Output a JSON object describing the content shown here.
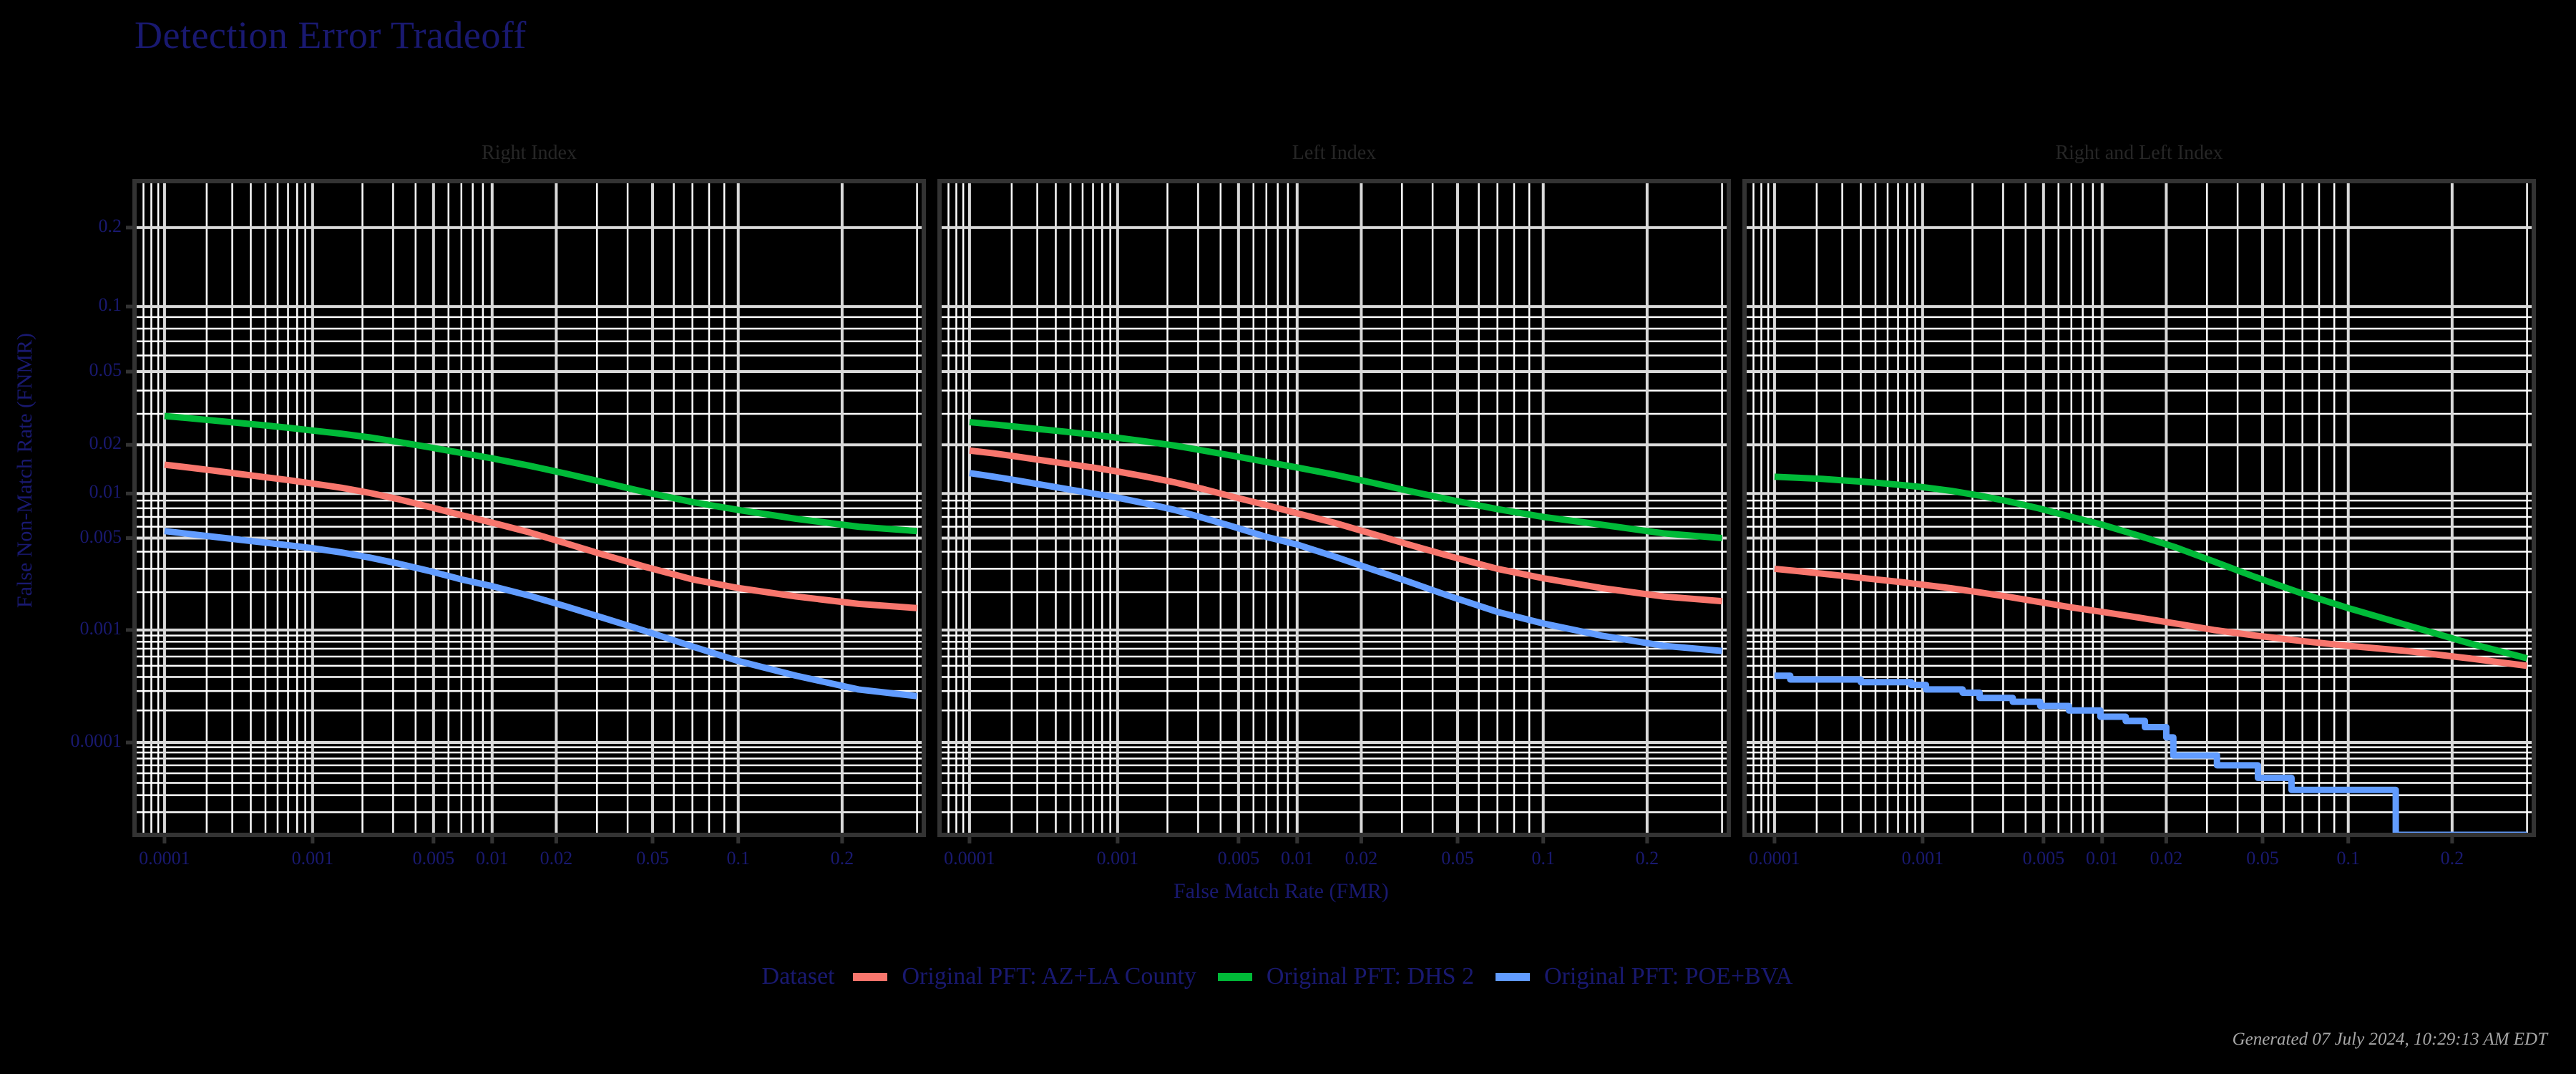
{
  "title": "Detection Error Tradeoff",
  "axes": {
    "x_title": "False Match Rate (FMR)",
    "y_title": "False Non-Match Rate (FNMR)",
    "x_ticks": [
      "0.0001",
      "0.001",
      "0.005",
      "0.01",
      "0.02",
      "0.05",
      "0.1",
      "0.2"
    ],
    "y_ticks": [
      "0.2",
      "0.1",
      "0.05",
      "0.02",
      "0.01",
      "0.005",
      "0.001",
      "0.0001"
    ]
  },
  "panels": [
    {
      "label": "Right Index"
    },
    {
      "label": "Left Index"
    },
    {
      "label": "Right and Left Index"
    }
  ],
  "legend": {
    "title": "Dataset",
    "items": [
      {
        "label": "Original PFT: AZ+LA County",
        "color": "#F8766D"
      },
      {
        "label": "Original PFT: DHS 2",
        "color": "#00BA38"
      },
      {
        "label": "Original PFT: POE+BVA",
        "color": "#619CFF"
      }
    ]
  },
  "caption": "Generated 07 July 2024, 10:29:13 AM EDT",
  "colors": {
    "title": "#191970",
    "strip": "#262626",
    "background": "#000000",
    "grid_major": "#d9d9d9",
    "grid_minor": "#ffffff",
    "panel_border": "#333333",
    "caption": "#a6a6a6"
  },
  "chart_data": {
    "type": "line",
    "title": "Detection Error Tradeoff",
    "xlabel": "False Match Rate (FMR)",
    "ylabel": "False Non-Match Rate (FNMR)",
    "xscale": "probit",
    "yscale": "probit",
    "xlim": [
      6e-05,
      0.31
    ],
    "ylim": [
      1.15e-05,
      0.28
    ],
    "xticks": [
      0.0001,
      0.001,
      0.005,
      0.01,
      0.02,
      0.05,
      0.1,
      0.2
    ],
    "yticks": [
      0.2,
      0.1,
      0.05,
      0.02,
      0.01,
      0.005,
      0.001,
      0.0001
    ],
    "grid": true,
    "legend_position": "bottom",
    "facets": [
      {
        "name": "Right Index",
        "series": [
          {
            "name": "Original PFT: AZ+LA County",
            "color": "#F8766D",
            "x": [
              0.0001,
              0.00015,
              0.00022,
              0.00032,
              0.00047,
              0.0007,
              0.001,
              0.0015,
              0.0022,
              0.0032,
              0.0047,
              0.007,
              0.01,
              0.015,
              0.022,
              0.032,
              0.047,
              0.07,
              0.1,
              0.15,
              0.22,
              0.3
            ],
            "y": [
              0.0152,
              0.0146,
              0.014,
              0.0134,
              0.0128,
              0.0122,
              0.0116,
              0.0109,
              0.0101,
              0.0092,
              0.0082,
              0.0072,
              0.0064,
              0.0055,
              0.0046,
              0.0038,
              0.0031,
              0.0025,
              0.00215,
              0.00185,
              0.00162,
              0.0015
            ]
          },
          {
            "name": "Original PFT: DHS 2",
            "color": "#00BA38",
            "x": [
              0.0001,
              0.00015,
              0.00022,
              0.00032,
              0.00047,
              0.0007,
              0.001,
              0.0015,
              0.0022,
              0.0032,
              0.0047,
              0.007,
              0.01,
              0.015,
              0.022,
              0.032,
              0.047,
              0.07,
              0.1,
              0.15,
              0.22,
              0.3
            ],
            "y": [
              0.0292,
              0.0284,
              0.0276,
              0.0268,
              0.026,
              0.0251,
              0.0242,
              0.0232,
              0.0221,
              0.0208,
              0.0194,
              0.0179,
              0.0166,
              0.015,
              0.0134,
              0.0118,
              0.0102,
              0.0088,
              0.0078,
              0.0068,
              0.006,
              0.0056
            ]
          },
          {
            "name": "Original PFT: POE+BVA",
            "color": "#619CFF",
            "x": [
              0.0001,
              0.00015,
              0.00022,
              0.00032,
              0.00047,
              0.0007,
              0.001,
              0.0015,
              0.0022,
              0.0032,
              0.0047,
              0.007,
              0.01,
              0.015,
              0.022,
              0.032,
              0.047,
              0.07,
              0.1,
              0.15,
              0.22,
              0.3
            ],
            "y": [
              0.0056,
              0.00535,
              0.00512,
              0.0049,
              0.00468,
              0.00445,
              0.00424,
              0.00395,
              0.00363,
              0.00328,
              0.0029,
              0.0025,
              0.00222,
              0.00188,
              0.00155,
              0.00125,
              0.00098,
              0.00073,
              0.00055,
              0.00041,
              0.00031,
              0.00027
            ]
          }
        ]
      },
      {
        "name": "Left Index",
        "series": [
          {
            "name": "Original PFT: AZ+LA County",
            "color": "#F8766D",
            "x": [
              0.0001,
              0.00015,
              0.00022,
              0.00032,
              0.00047,
              0.0007,
              0.001,
              0.0015,
              0.0022,
              0.0032,
              0.0047,
              0.007,
              0.01,
              0.015,
              0.022,
              0.032,
              0.047,
              0.07,
              0.1,
              0.15,
              0.22,
              0.3
            ],
            "y": [
              0.0185,
              0.0178,
              0.017,
              0.0162,
              0.0154,
              0.0146,
              0.0138,
              0.0128,
              0.0118,
              0.0107,
              0.0095,
              0.0084,
              0.0074,
              0.0064,
              0.0054,
              0.0045,
              0.0037,
              0.003,
              0.00255,
              0.00215,
              0.00185,
              0.0017
            ]
          },
          {
            "name": "Original PFT: DHS 2",
            "color": "#00BA38",
            "x": [
              0.0001,
              0.00015,
              0.00022,
              0.00032,
              0.00047,
              0.0007,
              0.001,
              0.0015,
              0.0022,
              0.0032,
              0.0047,
              0.007,
              0.01,
              0.015,
              0.022,
              0.032,
              0.047,
              0.07,
              0.1,
              0.15,
              0.22,
              0.3
            ],
            "y": [
              0.027,
              0.0262,
              0.0254,
              0.0246,
              0.0238,
              0.0229,
              0.022,
              0.0209,
              0.0198,
              0.0185,
              0.0172,
              0.0158,
              0.0146,
              0.0132,
              0.0118,
              0.0104,
              0.0091,
              0.0079,
              0.007,
              0.0062,
              0.0054,
              0.005
            ]
          },
          {
            "name": "Original PFT: POE+BVA",
            "color": "#619CFF",
            "x": [
              0.0001,
              0.00015,
              0.00022,
              0.00032,
              0.00047,
              0.0007,
              0.001,
              0.0015,
              0.0022,
              0.0032,
              0.0047,
              0.007,
              0.01,
              0.015,
              0.022,
              0.032,
              0.047,
              0.07,
              0.1,
              0.15,
              0.22,
              0.3
            ],
            "y": [
              0.0135,
              0.0128,
              0.0121,
              0.0114,
              0.0107,
              0.01,
              0.0094,
              0.0086,
              0.0078,
              0.0069,
              0.006,
              0.0051,
              0.0045,
              0.0037,
              0.003,
              0.0024,
              0.00185,
              0.0014,
              0.00113,
              0.0009,
              0.00074,
              0.00067
            ]
          }
        ]
      },
      {
        "name": "Right and Left Index",
        "series": [
          {
            "name": "Original PFT: AZ+LA County",
            "color": "#F8766D",
            "x": [
              0.0001,
              0.00015,
              0.00022,
              0.00032,
              0.00047,
              0.0007,
              0.001,
              0.0015,
              0.0022,
              0.0032,
              0.0047,
              0.007,
              0.01,
              0.015,
              0.022,
              0.032,
              0.047,
              0.07,
              0.1,
              0.15,
              0.22,
              0.3
            ],
            "y": [
              0.003,
              0.00288,
              0.00276,
              0.00264,
              0.00252,
              0.0024,
              0.00228,
              0.00214,
              0.00199,
              0.00184,
              0.00168,
              0.00152,
              0.0014,
              0.00126,
              0.00113,
              0.001,
              0.0009,
              0.00081,
              0.00074,
              0.00067,
              0.00058,
              0.0005
            ]
          },
          {
            "name": "Original PFT: DHS 2",
            "color": "#00BA38",
            "x": [
              0.0001,
              0.00015,
              0.00022,
              0.00032,
              0.00047,
              0.0007,
              0.001,
              0.0015,
              0.0022,
              0.0032,
              0.0047,
              0.007,
              0.01,
              0.015,
              0.022,
              0.032,
              0.047,
              0.07,
              0.1,
              0.15,
              0.22,
              0.3
            ],
            "y": [
              0.0128,
              0.0126,
              0.0124,
              0.0121,
              0.0118,
              0.0114,
              0.011,
              0.0104,
              0.0097,
              0.0089,
              0.008,
              0.007,
              0.0062,
              0.0052,
              0.0043,
              0.0034,
              0.0026,
              0.00195,
              0.0015,
              0.0011,
              0.00078,
              0.00058
            ]
          },
          {
            "name": "Original PFT: POE+BVA",
            "color": "#619CFF",
            "steps": true,
            "x": [
              0.0001,
              0.00013,
              0.00013,
              0.0004,
              0.0004,
              0.00085,
              0.00085,
              0.00105,
              0.00105,
              0.00175,
              0.00175,
              0.0022,
              0.0022,
              0.0034,
              0.0034,
              0.0048,
              0.0048,
              0.0068,
              0.0068,
              0.0098,
              0.0098,
              0.013,
              0.013,
              0.016,
              0.016,
              0.02,
              0.02,
              0.0215,
              0.0215,
              0.033,
              0.033,
              0.048,
              0.048,
              0.064,
              0.064,
              0.135,
              0.135,
              0.14,
              0.14,
              0.3
            ],
            "y": [
              0.00041,
              0.00041,
              0.00038,
              0.00038,
              0.00036,
              0.00036,
              0.00034,
              0.00034,
              0.00031,
              0.00031,
              0.00029,
              0.00029,
              0.00026,
              0.00026,
              0.00024,
              0.00024,
              0.00022,
              0.00022,
              0.0002,
              0.0002,
              0.000175,
              0.000175,
              0.00016,
              0.00016,
              0.00014,
              0.00014,
              0.000112,
              0.000112,
              7.5e-05,
              7.5e-05,
              6e-05,
              6e-05,
              4.5e-05,
              4.5e-05,
              3.4e-05,
              3.4e-05,
              3.4e-05,
              3.4e-05,
              1.15e-05,
              1.15e-05
            ]
          }
        ]
      }
    ]
  }
}
